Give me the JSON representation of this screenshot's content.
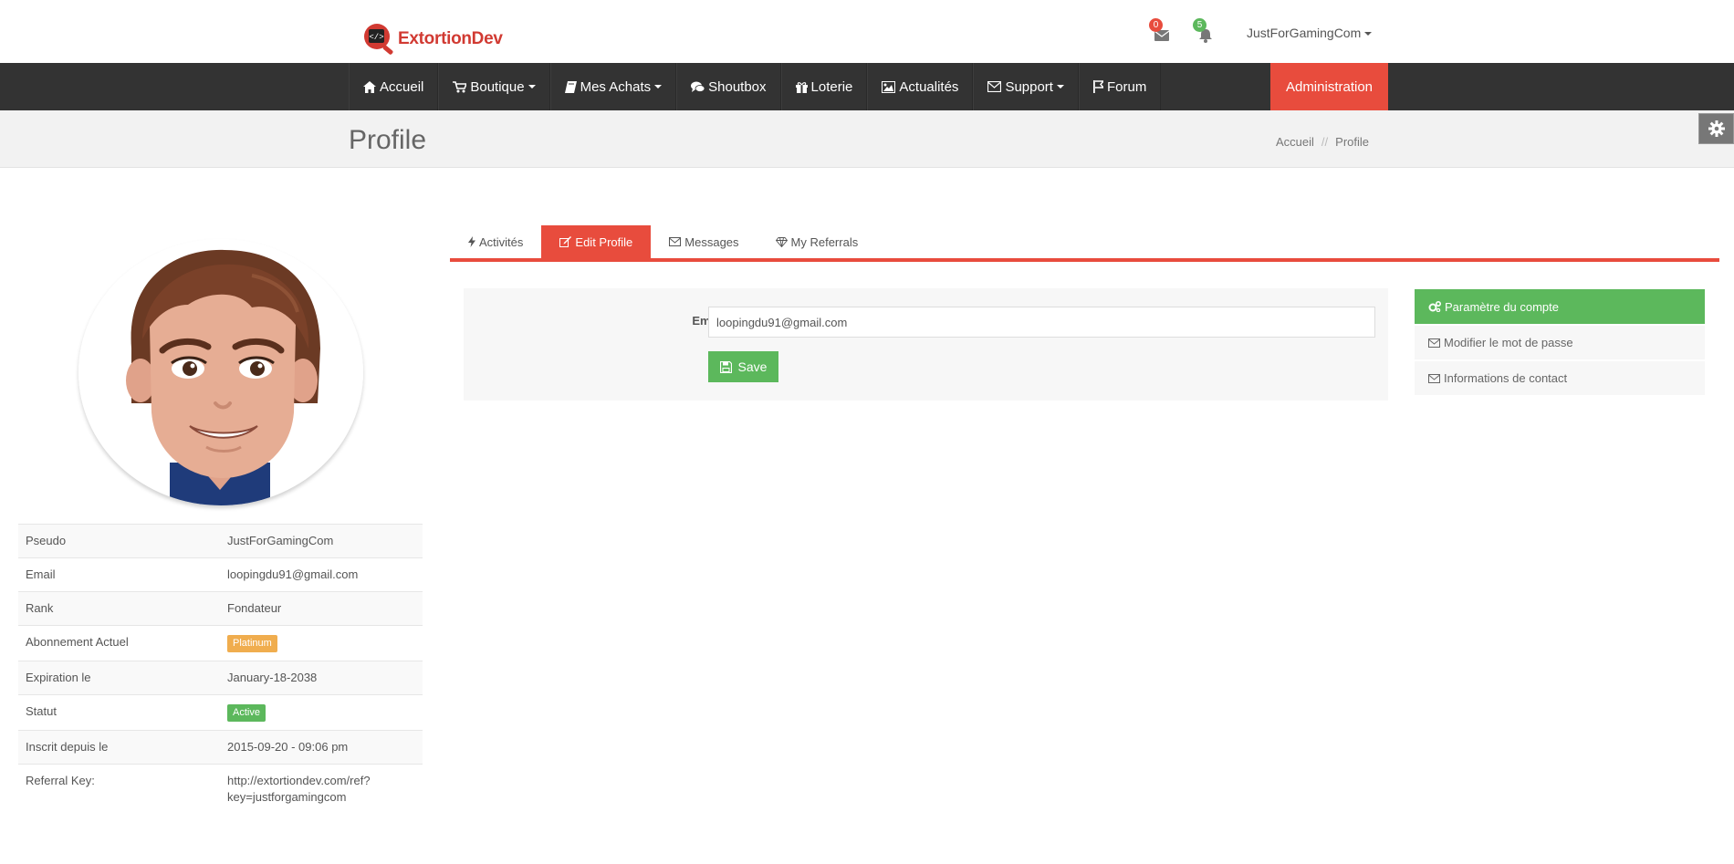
{
  "brand": {
    "name": "ExtortionDev",
    "accent": "#e84c3d",
    "success": "#5cb85c"
  },
  "header": {
    "messages_icon": "envelope-icon",
    "messages_count": "0",
    "notifications_icon": "bell-icon",
    "notifications_count": "5",
    "username": "JustForGamingCom"
  },
  "nav": {
    "items": [
      {
        "label": "Accueil",
        "icon": "home-icon"
      },
      {
        "label": "Boutique",
        "icon": "cart-icon",
        "dropdown": true
      },
      {
        "label": "Mes Achats",
        "icon": "book-icon",
        "dropdown": true
      },
      {
        "label": "Shoutbox",
        "icon": "comments-icon"
      },
      {
        "label": "Loterie",
        "icon": "gift-icon"
      },
      {
        "label": "Actualités",
        "icon": "image-icon"
      },
      {
        "label": "Support",
        "icon": "envelope-icon",
        "dropdown": true
      },
      {
        "label": "Forum",
        "icon": "flag-icon"
      }
    ],
    "admin_label": "Administration"
  },
  "page": {
    "title": "Profile",
    "breadcrumb": [
      "Accueil",
      "//",
      "Profile"
    ]
  },
  "profile": {
    "rows": [
      {
        "key": "Pseudo",
        "value": "JustForGamingCom"
      },
      {
        "key": "Email",
        "value": "loopingdu91@gmail.com"
      },
      {
        "key": "Rank",
        "value": "Fondateur"
      },
      {
        "key": "Abonnement Actuel",
        "value": "Platinum",
        "badge_color": "#f0ad4e"
      },
      {
        "key": "Expiration le",
        "value": "January-18-2038"
      },
      {
        "key": "Statut",
        "value": "Active",
        "badge_color": "#5cb85c"
      },
      {
        "key": "Inscrit depuis le",
        "value": "2015-09-20 - 09:06 pm"
      },
      {
        "key": "Referral Key:",
        "value": "http://extortiondev.com/ref?key=justforgamingcom",
        "line1": "http://extortiondev.com/ref?",
        "line2": "key=justforgamingcom"
      }
    ]
  },
  "tabs": [
    {
      "label": "Activités",
      "icon": "bolt-icon"
    },
    {
      "label": "Edit Profile",
      "icon": "edit-icon",
      "active": true
    },
    {
      "label": "Messages",
      "icon": "envelope-icon"
    },
    {
      "label": "My Referrals",
      "icon": "diamond-icon"
    }
  ],
  "form": {
    "email_label": "Email",
    "email_value": "loopingdu91@gmail.com",
    "save_label": "Save"
  },
  "side_menu": [
    {
      "label": "Paramètre du compte",
      "icon": "cogs-icon",
      "active": true
    },
    {
      "label": "Modifier le mot de passe",
      "icon": "envelope-icon"
    },
    {
      "label": "Informations de contact",
      "icon": "envelope-icon"
    }
  ]
}
